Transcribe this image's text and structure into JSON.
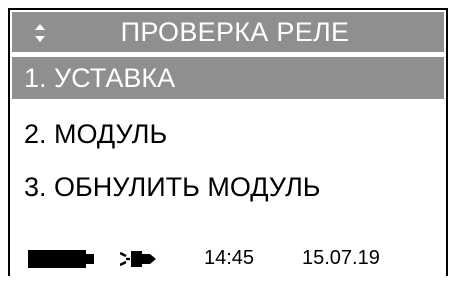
{
  "title": "ПРОВЕРКА РЕЛЕ",
  "title_icon": "up-down-arrows-icon",
  "menu": {
    "items": [
      {
        "label": "1. УСТАВКА",
        "selected": true
      },
      {
        "label": "2. МОДУЛЬ",
        "selected": false
      },
      {
        "label": "3. ОБНУЛИТЬ МОДУЛЬ",
        "selected": false
      }
    ]
  },
  "status": {
    "battery_icon": "battery-icon",
    "power_icon": "power-plug-icon",
    "time": "14:45",
    "date": "15.07.19"
  },
  "colors": {
    "highlight": "#8f8f8f",
    "background": "#ffffff",
    "text": "#000000"
  }
}
